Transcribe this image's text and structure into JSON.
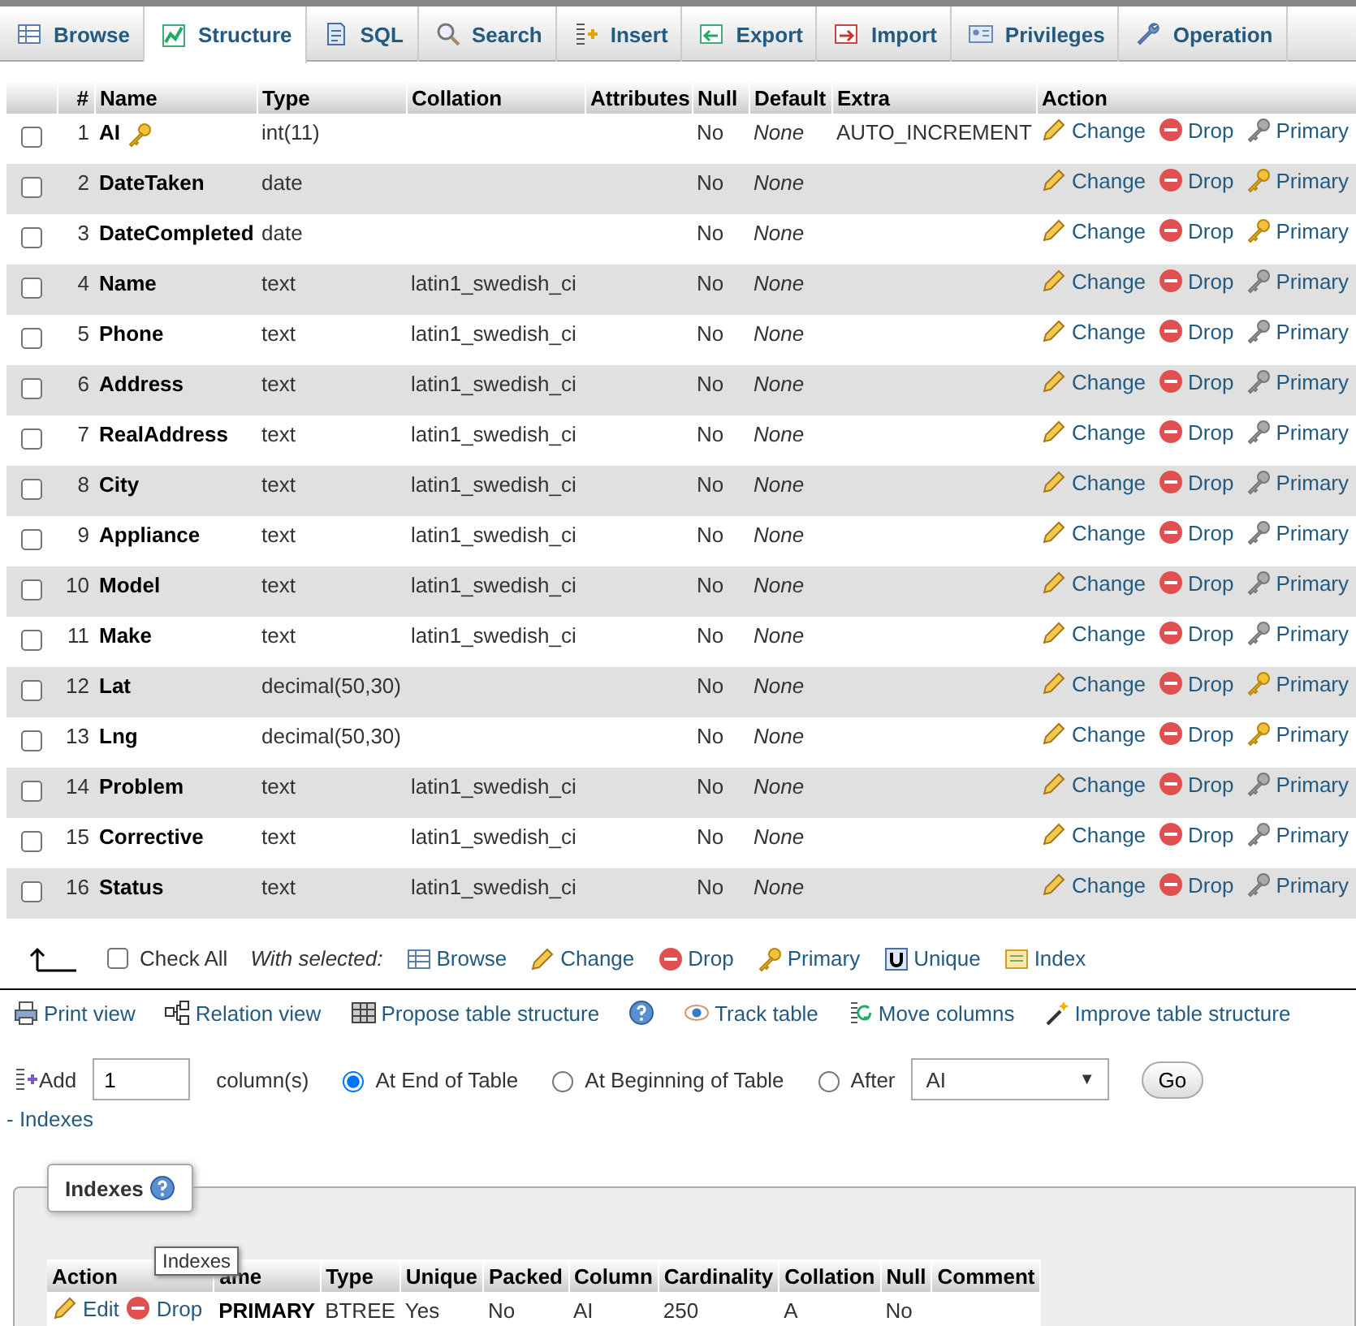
{
  "tabs": [
    {
      "kind": "browse",
      "label": "Browse",
      "selected": false
    },
    {
      "kind": "structure",
      "label": "Structure",
      "selected": true
    },
    {
      "kind": "sql",
      "label": "SQL",
      "selected": false
    },
    {
      "kind": "search",
      "label": "Search",
      "selected": false
    },
    {
      "kind": "insert",
      "label": "Insert",
      "selected": false
    },
    {
      "kind": "export",
      "label": "Export",
      "selected": false
    },
    {
      "kind": "import",
      "label": "Import",
      "selected": false
    },
    {
      "kind": "privileges",
      "label": "Privileges",
      "selected": false
    },
    {
      "kind": "operations",
      "label": "Operation",
      "selected": false
    }
  ],
  "table": {
    "columns": [
      "#",
      "Name",
      "Type",
      "Collation",
      "Attributes",
      "Null",
      "Default",
      "Extra",
      "Action"
    ],
    "rows": [
      {
        "checked": false,
        "number": "1",
        "name": "AI",
        "primary_key": true,
        "type": "int(11)",
        "collation": "",
        "null": "No",
        "default": "None",
        "extra": "AUTO_INCREMENT",
        "primary_enabled": false,
        "actions": [
          "Change",
          "Drop",
          "Primary"
        ]
      },
      {
        "checked": false,
        "number": "2",
        "name": "DateTaken",
        "primary_key": false,
        "type": "date",
        "collation": "",
        "null": "No",
        "default": "None",
        "extra": "",
        "primary_enabled": true,
        "actions": [
          "Change",
          "Drop",
          "Primary"
        ]
      },
      {
        "checked": false,
        "number": "3",
        "name": "DateCompleted",
        "primary_key": false,
        "type": "date",
        "collation": "",
        "null": "No",
        "default": "None",
        "extra": "",
        "primary_enabled": true,
        "actions": [
          "Change",
          "Drop",
          "Primary"
        ]
      },
      {
        "checked": false,
        "number": "4",
        "name": "Name",
        "primary_key": false,
        "type": "text",
        "collation": "latin1_swedish_ci",
        "null": "No",
        "default": "None",
        "extra": "",
        "primary_enabled": false,
        "actions": [
          "Change",
          "Drop",
          "Primary"
        ]
      },
      {
        "checked": false,
        "number": "5",
        "name": "Phone",
        "primary_key": false,
        "type": "text",
        "collation": "latin1_swedish_ci",
        "null": "No",
        "default": "None",
        "extra": "",
        "primary_enabled": false,
        "actions": [
          "Change",
          "Drop",
          "Primary"
        ]
      },
      {
        "checked": false,
        "number": "6",
        "name": "Address",
        "primary_key": false,
        "type": "text",
        "collation": "latin1_swedish_ci",
        "null": "No",
        "default": "None",
        "extra": "",
        "primary_enabled": false,
        "actions": [
          "Change",
          "Drop",
          "Primary"
        ]
      },
      {
        "checked": false,
        "number": "7",
        "name": "RealAddress",
        "primary_key": false,
        "type": "text",
        "collation": "latin1_swedish_ci",
        "null": "No",
        "default": "None",
        "extra": "",
        "primary_enabled": false,
        "actions": [
          "Change",
          "Drop",
          "Primary"
        ]
      },
      {
        "checked": false,
        "number": "8",
        "name": "City",
        "primary_key": false,
        "type": "text",
        "collation": "latin1_swedish_ci",
        "null": "No",
        "default": "None",
        "extra": "",
        "primary_enabled": false,
        "actions": [
          "Change",
          "Drop",
          "Primary"
        ]
      },
      {
        "checked": false,
        "number": "9",
        "name": "Appliance",
        "primary_key": false,
        "type": "text",
        "collation": "latin1_swedish_ci",
        "null": "No",
        "default": "None",
        "extra": "",
        "primary_enabled": false,
        "actions": [
          "Change",
          "Drop",
          "Primary"
        ]
      },
      {
        "checked": false,
        "number": "10",
        "name": "Model",
        "primary_key": false,
        "type": "text",
        "collation": "latin1_swedish_ci",
        "null": "No",
        "default": "None",
        "extra": "",
        "primary_enabled": false,
        "actions": [
          "Change",
          "Drop",
          "Primary"
        ]
      },
      {
        "checked": false,
        "number": "11",
        "name": "Make",
        "primary_key": false,
        "type": "text",
        "collation": "latin1_swedish_ci",
        "null": "No",
        "default": "None",
        "extra": "",
        "primary_enabled": false,
        "actions": [
          "Change",
          "Drop",
          "Primary"
        ]
      },
      {
        "checked": false,
        "number": "12",
        "name": "Lat",
        "primary_key": false,
        "type": "decimal(50,30)",
        "collation": "",
        "null": "No",
        "default": "None",
        "extra": "",
        "primary_enabled": true,
        "actions": [
          "Change",
          "Drop",
          "Primary"
        ]
      },
      {
        "checked": false,
        "number": "13",
        "name": "Lng",
        "primary_key": false,
        "type": "decimal(50,30)",
        "collation": "",
        "null": "No",
        "default": "None",
        "extra": "",
        "primary_enabled": true,
        "actions": [
          "Change",
          "Drop",
          "Primary"
        ]
      },
      {
        "checked": false,
        "number": "14",
        "name": "Problem",
        "primary_key": false,
        "type": "text",
        "collation": "latin1_swedish_ci",
        "null": "No",
        "default": "None",
        "extra": "",
        "primary_enabled": false,
        "actions": [
          "Change",
          "Drop",
          "Primary"
        ]
      },
      {
        "checked": false,
        "number": "15",
        "name": "Corrective",
        "primary_key": false,
        "type": "text",
        "collation": "latin1_swedish_ci",
        "null": "No",
        "default": "None",
        "extra": "",
        "primary_enabled": false,
        "actions": [
          "Change",
          "Drop",
          "Primary"
        ]
      },
      {
        "checked": false,
        "number": "16",
        "name": "Status",
        "primary_key": false,
        "type": "text",
        "collation": "latin1_swedish_ci",
        "null": "No",
        "default": "None",
        "extra": "",
        "primary_enabled": false,
        "actions": [
          "Change",
          "Drop",
          "Primary"
        ]
      }
    ]
  },
  "bulk": {
    "check_all": {
      "label": "Check All",
      "checked": false
    },
    "with_selected": "With selected:",
    "actions": [
      {
        "kind": "browse",
        "label": "Browse"
      },
      {
        "kind": "change",
        "label": "Change"
      },
      {
        "kind": "drop",
        "label": "Drop"
      },
      {
        "kind": "primary",
        "label": "Primary"
      },
      {
        "kind": "unique",
        "label": "Unique"
      },
      {
        "kind": "index",
        "label": "Index"
      }
    ]
  },
  "links": [
    {
      "kind": "print",
      "label": "Print view"
    },
    {
      "kind": "relation",
      "label": "Relation view"
    },
    {
      "kind": "propose",
      "label": "Propose table structure"
    },
    {
      "kind": "help"
    },
    {
      "kind": "track",
      "label": "Track table"
    },
    {
      "kind": "move",
      "label": "Move columns"
    },
    {
      "kind": "improve",
      "label": "Improve table structure"
    }
  ],
  "add_column": {
    "label": "Add",
    "count": "1",
    "unit": "column(s)",
    "positions": [
      {
        "label": "At End of Table",
        "selected": true
      },
      {
        "label": "At Beginning of Table",
        "selected": false
      },
      {
        "label": "After",
        "selected": false
      }
    ],
    "after_column": "AI",
    "select_arrow": "▼",
    "go": "Go"
  },
  "indexes_toggle": "- Indexes",
  "indexes": {
    "legend": "Indexes",
    "tooltip": "Indexes",
    "columns": [
      "Action",
      "ame",
      "Type",
      "Unique",
      "Packed",
      "Column",
      "Cardinality",
      "Collation",
      "Null",
      "Comment"
    ],
    "rows": [
      {
        "actions": [
          "Edit",
          "Drop"
        ],
        "name": "PRIMARY",
        "type": "BTREE",
        "unique": "Yes",
        "packed": "No",
        "column": "AI",
        "cardinality": "250",
        "collation": "A",
        "null": "No",
        "comment": ""
      }
    ]
  }
}
